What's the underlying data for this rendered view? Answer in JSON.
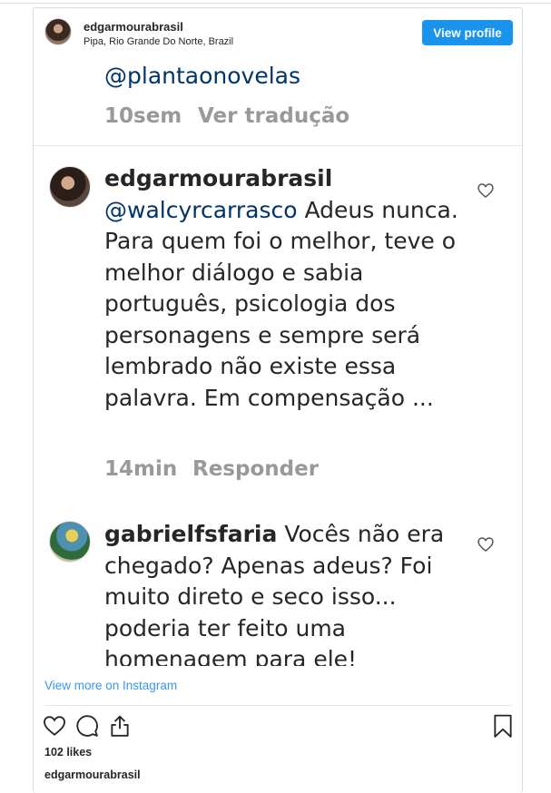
{
  "header": {
    "username": "edgarmourabrasil",
    "location": "Pipa, Rio Grande Do Norte, Brazil",
    "view_profile_label": "View profile"
  },
  "screenshot": {
    "first": {
      "mention": "@plantaonovelas",
      "time": "10sem",
      "translate_label": "Ver tradução"
    },
    "comments": [
      {
        "username": "edgarmourabrasil",
        "mention": "@walcyrcarrasco",
        "text": "Adeus nunca. Para quem foi o melhor, teve o melhor diálogo e sabia português, psicologia dos personagens e sempre será lembrado não existe essa palavra. Em compensação ...",
        "time": "14min",
        "reply_label": "Responder"
      },
      {
        "username": "gabrielfsfaria",
        "text": "Vocês não era chegado? Apenas adeus? Foi muito direto e seco isso... poderia ter feito uma homenagem para ele!"
      }
    ]
  },
  "footer": {
    "view_more_label": "View more on Instagram",
    "likes": "102 likes",
    "caption_username": "edgarmourabrasil"
  },
  "icons": [
    "heart-icon",
    "comment-icon",
    "share-icon",
    "bookmark-icon"
  ],
  "colors": {
    "button": "#1a93ed",
    "link": "#3897f0",
    "mention": "#003569",
    "meta_gray": "#999999"
  }
}
